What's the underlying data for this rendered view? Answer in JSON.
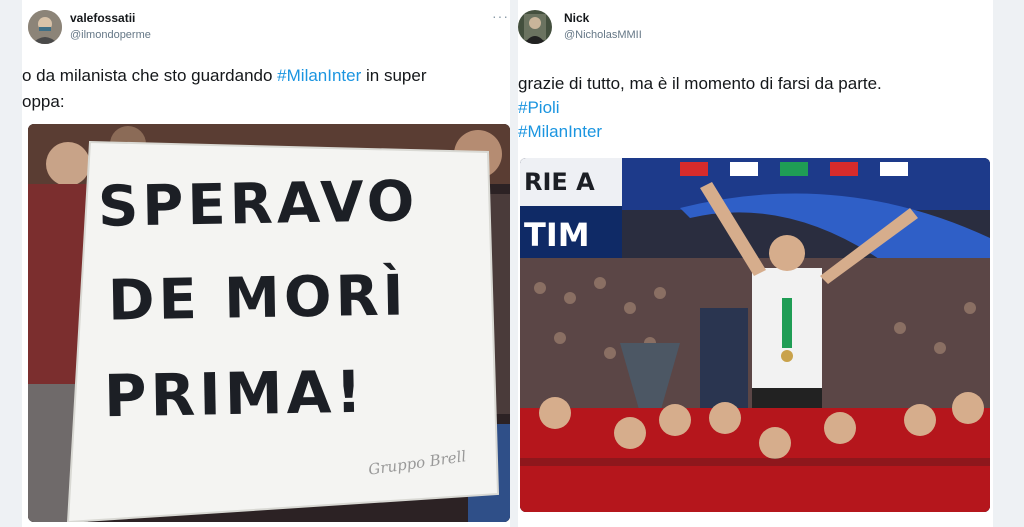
{
  "tweet1": {
    "name": "valefossatii",
    "handle": "@ilmondoperme",
    "more": "···",
    "text_line1_a": "o da milanista che sto guardando ",
    "hashtag": "#MilanInter",
    "text_line1_b": " in super",
    "text_line2": "oppa:",
    "banner": {
      "line1": "SPERAVO",
      "line2": "DE MORÌ",
      "line3": "PRIMA!",
      "signature": "Gruppo Brell"
    }
  },
  "tweet2": {
    "name": "Nick",
    "handle": "@NicholasMMII",
    "text_line1": "grazie di tutto, ma è il momento di farsi da parte.",
    "hashtag1": "#Pioli",
    "hashtag2": "#MilanInter",
    "ad_board": {
      "line1": "RIE A",
      "line2": "TIM"
    }
  },
  "colors": {
    "link": "#1b95e0",
    "ad_navy": "#0f2a66",
    "ad_red": "#d72b2b",
    "ad_green": "#1f9d55",
    "milan_red": "#b5161c"
  }
}
